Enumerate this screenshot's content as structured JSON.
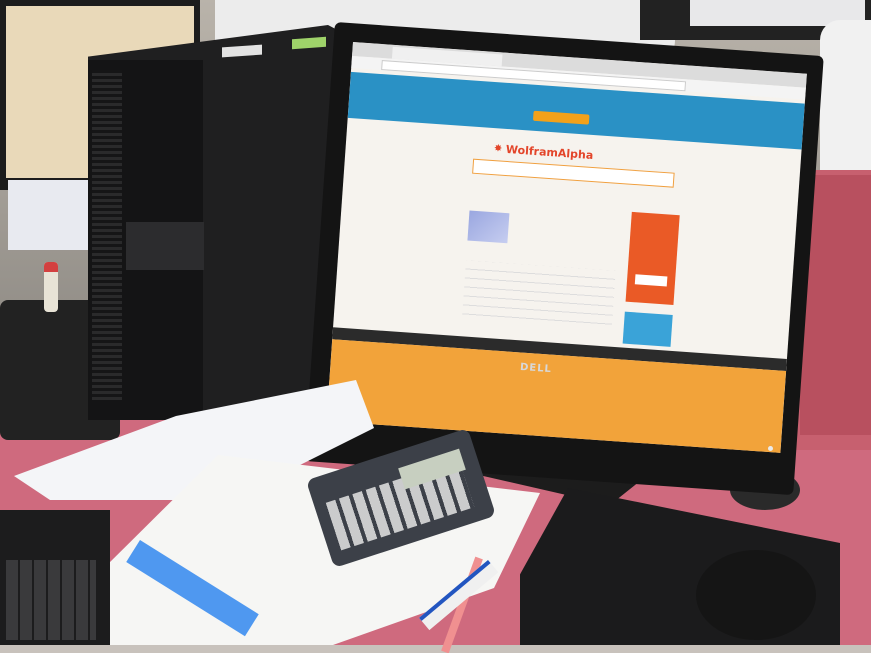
{
  "scene": {
    "description_free": true
  },
  "screen": {
    "banner_text": "",
    "banner_button": "",
    "logo": "WolframAlpha",
    "query": "",
    "ad_text": "",
    "ad_button": "",
    "pro_text": ""
  },
  "monitor": {
    "brand": "DELL"
  },
  "mouse": {
    "brand": ""
  },
  "colors": {
    "desk": "#cf6a7e",
    "banner": "#2a91c5",
    "wolfram_orange": "#e3452a",
    "ad_orange": "#ea5a26",
    "taskbar_orange": "#f2a33a"
  }
}
